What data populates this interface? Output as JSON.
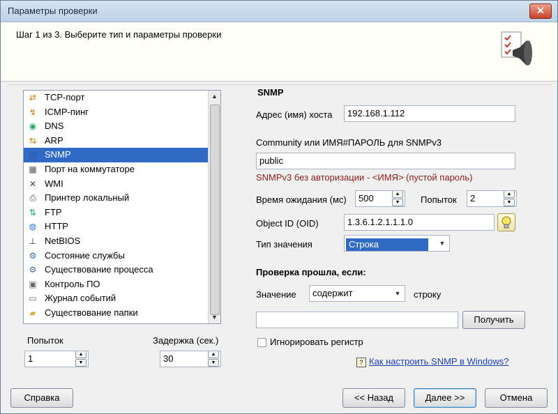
{
  "window": {
    "title": "Параметры проверки",
    "close_label": "✕"
  },
  "header": {
    "step": "Шаг 1 из 3. Выберите тип и параметры проверки"
  },
  "checks_list": {
    "items": [
      {
        "label": "TCP-порт",
        "icon": "tcp-port-icon"
      },
      {
        "label": "ICMP-пинг",
        "icon": "icmp-ping-icon"
      },
      {
        "label": "DNS",
        "icon": "dns-icon"
      },
      {
        "label": "ARP",
        "icon": "arp-icon"
      },
      {
        "label": "SNMP",
        "icon": "snmp-icon",
        "selected": true
      },
      {
        "label": "Порт на коммутаторе",
        "icon": "switch-port-icon"
      },
      {
        "label": "WMI",
        "icon": "wmi-icon"
      },
      {
        "label": "Принтер локальный",
        "icon": "printer-icon"
      },
      {
        "label": "FTP",
        "icon": "ftp-icon"
      },
      {
        "label": "HTTP",
        "icon": "http-icon"
      },
      {
        "label": "NetBIOS",
        "icon": "netbios-icon"
      },
      {
        "label": "Состояние службы",
        "icon": "service-icon"
      },
      {
        "label": "Существование процесса",
        "icon": "process-icon"
      },
      {
        "label": "Контроль ПО",
        "icon": "software-icon"
      },
      {
        "label": "Журнал событий",
        "icon": "event-log-icon"
      },
      {
        "label": "Существование папки",
        "icon": "folder-icon"
      }
    ]
  },
  "left_bottom": {
    "attempts_label": "Попыток",
    "attempts_value": "1",
    "delay_label": "Задержка (сек.)",
    "delay_value": "30"
  },
  "snmp": {
    "group_title": "SNMP",
    "host_label": "Адрес (имя) хоста",
    "host_value": "192.168.1.112",
    "community_label": "Community или ИМЯ#ПАРОЛЬ для SNMPv3",
    "community_value": "public",
    "community_hint": "SNMPv3 без авторизации - <ИМЯ> (пустой пароль)",
    "timeout_label": "Время ожидания (мс)",
    "timeout_value": "500",
    "tries_label": "Попыток",
    "tries_value": "2",
    "oid_label": "Object ID (OID)",
    "oid_value": "1.3.6.1.2.1.1.1.0",
    "value_type_label": "Тип значения",
    "value_type_value": "Строка",
    "condition_title": "Проверка прошла, если:",
    "value_label": "Значение",
    "condition_value": "содержит",
    "string_label": "строку",
    "compare_value": "",
    "get_button": "Получить",
    "ignore_case_label": "Игнорировать регистр",
    "ignore_case_checked": false,
    "help_link": "Как настроить SNMP в Windows?"
  },
  "footer": {
    "help": "Справка",
    "back": "<< Назад",
    "next": "Далее >>",
    "cancel": "Отмена"
  }
}
